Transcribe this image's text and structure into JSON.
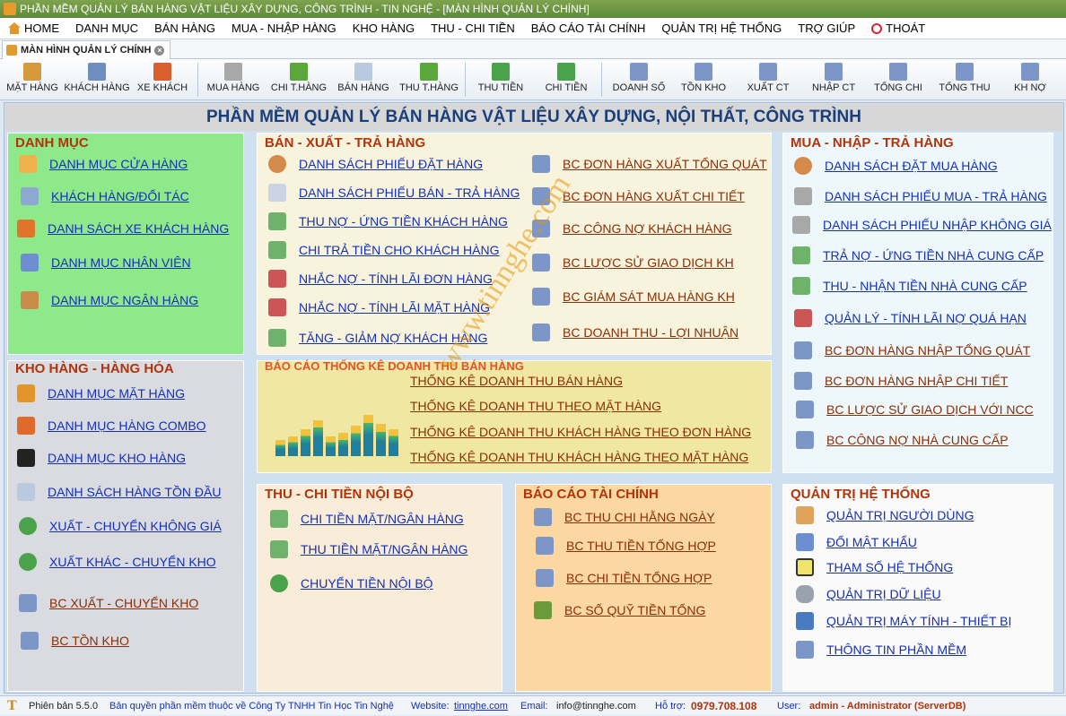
{
  "window": {
    "title": "PHẦN MỀM QUẢN LÝ BÁN HÀNG VẬT LIỆU XÂY DỰNG, CÔNG TRÌNH - TIN NGHỆ - [MÀN HÌNH QUẢN LÝ CHÍNH]"
  },
  "menu": [
    "HOME",
    "DANH MỤC",
    "BÁN HÀNG",
    "MUA - NHẬP HÀNG",
    "KHO HÀNG",
    "THU - CHI TIỀN",
    "BÁO CÁO TÀI CHÍNH",
    "QUẢN TRỊ HỆ THỐNG",
    "TRỢ GIÚP",
    "THOÁT"
  ],
  "tab": {
    "label": "MÀN HÌNH QUẢN LÝ CHÍNH",
    "close": "×"
  },
  "toolbar": [
    "MẶT HÀNG",
    "KHÁCH HÀNG",
    "XE KHÁCH",
    "MUA HÀNG",
    "CHI T.HÀNG",
    "BÁN HÀNG",
    "THU T.HÀNG",
    "THU TIỀN",
    "CHI TIỀN",
    "DOANH SỐ",
    "TỒN KHO",
    "XUẤT CT",
    "NHẬP CT",
    "TỔNG CHI",
    "TỔNG THU",
    "KH NỢ"
  ],
  "header": "PHẦN MỀM QUẢN LÝ BÁN HÀNG VẬT LIỆU XÂY DỰNG, NỘI THẤT, CÔNG TRÌNH",
  "danh_muc": {
    "title": "DANH MỤC",
    "items": [
      "DANH MỤC CỬA HÀNG",
      "KHÁCH HÀNG/ĐỐI TÁC",
      "DANH SÁCH XE KHÁCH HÀNG",
      "DANH MỤC NHÂN VIÊN",
      "DANH MỤC NGÂN HÀNG"
    ]
  },
  "ban_xuat": {
    "title": "BÁN - XUẤT - TRẢ HÀNG",
    "left": [
      "DANH SÁCH PHIẾU ĐẶT HÀNG",
      "DANH SÁCH PHIẾU BÁN - TRẢ HÀNG",
      "THU NỢ - ỨNG TIỀN KHÁCH HÀNG",
      "CHI TRẢ TIỀN CHO KHÁCH HÀNG",
      "NHẮC NỢ - TÍNH LÃI  ĐƠN HÀNG",
      "NHẮC NỢ - TÍNH LÃI MẶT HÀNG",
      "TĂNG - GIẢM NỢ KHÁCH HÀNG"
    ],
    "right": [
      "BC ĐƠN HÀNG XUẤT TỔNG QUÁT",
      "BC ĐƠN HÀNG XUẤT CHI TIẾT",
      "BC CÔNG NỢ KHÁCH HÀNG",
      "BC LƯỢC SỬ GIAO DỊCH KH",
      "BC GIÁM SÁT MUA HÀNG KH",
      "BC DOANH THU - LỢI NHUẬN"
    ]
  },
  "mua_nhap": {
    "title": "MUA - NHẬP - TRẢ HÀNG",
    "items": [
      "DANH SÁCH ĐẶT MUA HÀNG",
      "DANH SÁCH PHIẾU MUA - TRẢ HÀNG",
      "DANH SÁCH PHIẾU NHẬP KHÔNG GIÁ",
      "TRẢ NỢ - ỨNG TIỀN NHÀ CUNG CẤP",
      "THU - NHẬN TIỀN NHÀ CUNG CẤP",
      "QUẢN LÝ - TÍNH LÃI  NỢ QUÁ HẠN",
      "BC ĐƠN HÀNG NHẬP TỔNG QUÁT",
      "BC ĐƠN HÀNG NHẬP CHI TIẾT",
      "BC LƯỢC SỬ GIAO DỊCH VỚI NCC",
      "BC CÔNG NỢ NHÀ CUNG CẤP"
    ]
  },
  "kho_hang": {
    "title": "KHO HÀNG - HÀNG HÓA",
    "items": [
      "DANH MỤC MẶT HÀNG",
      "DANH MỤC HÀNG COMBO",
      "DANH MỤC KHO HÀNG",
      "DANH SÁCH HÀNG TỒN ĐẦU",
      "XUẤT - CHUYỂN KHÔNG GIÁ",
      "XUẤT KHÁC - CHUYỂN KHO",
      "BC XUẤT - CHUYỂN KHO",
      "BC TỒN KHO"
    ]
  },
  "bao_cao_dt": {
    "title": "BÁO CÁO THỐNG KÊ DOANH THU BÁN HÀNG",
    "items": [
      "THỐNG KÊ DOANH THU BÁN HÀNG",
      "THỐNG KÊ DOANH THU THEO MẶT HÀNG",
      "THỐNG KÊ DOANH THU KHÁCH HÀNG THEO ĐƠN HÀNG",
      "THỐNG KÊ DOANH THU KHÁCH HÀNG THEO MẶT HÀNG"
    ]
  },
  "thu_chi": {
    "title": "THU - CHI TIỀN NỘI BỘ",
    "items": [
      "CHI TIỀN MẶT/NGÂN HÀNG",
      "THU TIỀN MẶT/NGÂN HÀNG",
      "CHUYỂN TIỀN NỘI BỘ"
    ]
  },
  "bao_cao_tc": {
    "title": "BÁO CÁO TÀI CHÍNH",
    "items": [
      "BC THU CHI HẰNG NGÀY",
      "BC THU TIỀN TỔNG HỢP",
      "BC CHI TIỀN TỔNG HỢP",
      "BC SỐ QUỸ TIỀN TỔNG"
    ]
  },
  "quan_tri": {
    "title": "QUẢN TRỊ HỆ THỐNG",
    "items": [
      "QUẢN TRỊ NGƯỜI DÙNG",
      "ĐỔI MẬT KHẨU",
      "THAM SỐ HỆ THỐNG",
      "QUẢN TRỊ DỮ LIỆU",
      "QUẢN TRỊ MÁY TÍNH - THIẾT BỊ",
      "THÔNG TIN PHẦN MỀM"
    ]
  },
  "status": {
    "version": "Phiên bản 5.5.0",
    "copyright": "Bản quyền phần mềm thuộc về Công Ty TNHH Tin Học Tin Nghệ",
    "website_label": "Website:",
    "website": "tinnghe.com",
    "email_label": "Email:",
    "email": "info@tinnghe.com",
    "support_label": "Hỗ trợ:",
    "support": "0979.708.108",
    "user_label": "User:",
    "user": "admin - Administrator (ServerDB)"
  },
  "watermark": "www.tinnghe.com"
}
